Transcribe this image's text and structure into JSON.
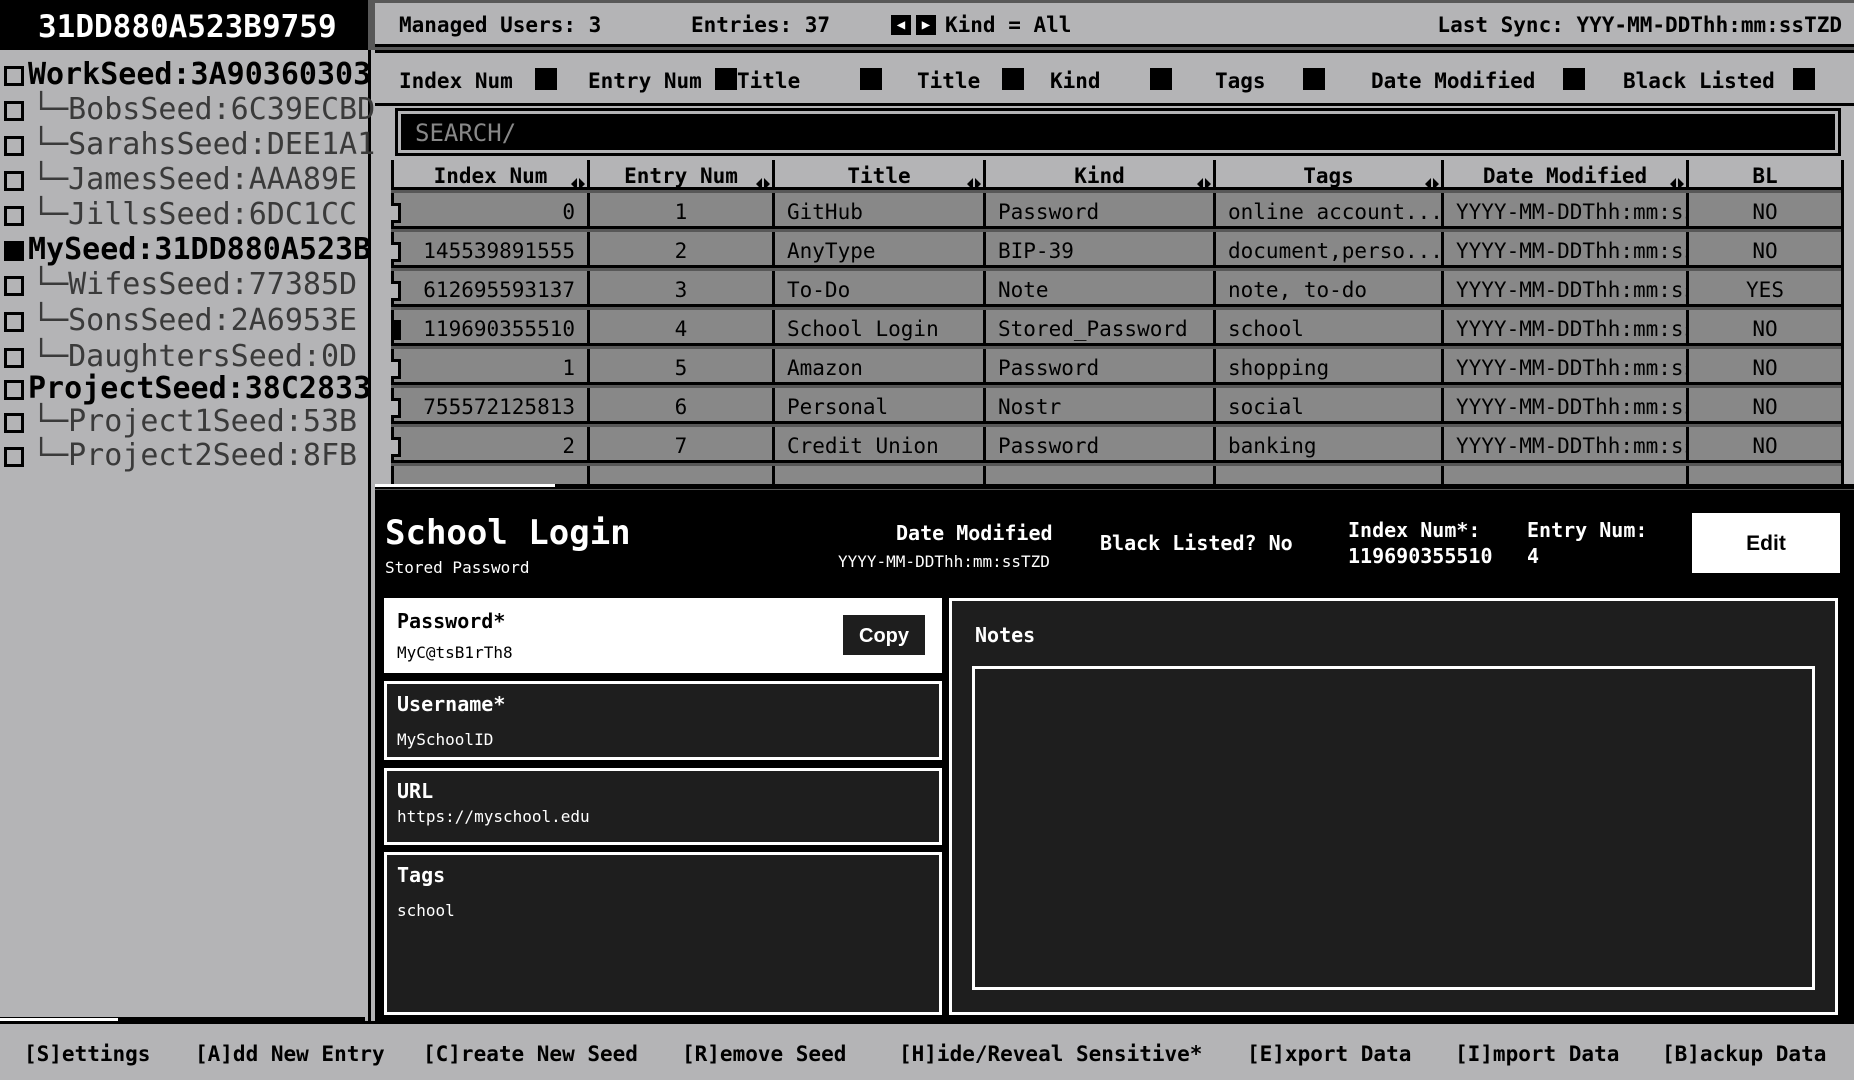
{
  "app": {
    "seed_title": "31DD880A523B9759"
  },
  "sidebar": {
    "items": [
      {
        "label": "WorkSeed:3A90360303",
        "type": "parent",
        "checked": false
      },
      {
        "label": "└─BobsSeed:6C39ECBD",
        "type": "child",
        "checked": false
      },
      {
        "label": "└─SarahsSeed:DEE1A1",
        "type": "child",
        "checked": false
      },
      {
        "label": "└─JamesSeed:AAA89E",
        "type": "child",
        "checked": false
      },
      {
        "label": "└─JillsSeed:6DC1CC",
        "type": "child",
        "checked": false
      },
      {
        "label": "MySeed:31DD880A523B",
        "type": "parent",
        "checked": true
      },
      {
        "label": "└─WifesSeed:77385D",
        "type": "child",
        "checked": false
      },
      {
        "label": "└─SonsSeed:2A6953E",
        "type": "child",
        "checked": false
      },
      {
        "label": "└─DaughtersSeed:0D",
        "type": "child",
        "checked": false
      },
      {
        "label": "ProjectSeed:38C2833",
        "type": "parent",
        "checked": false
      },
      {
        "label": "└─Project1Seed:53B",
        "type": "child",
        "checked": false
      },
      {
        "label": "└─Project2Seed:8FB",
        "type": "child",
        "checked": false
      }
    ]
  },
  "status": {
    "managed_users": "Managed Users: 3",
    "entries": "Entries: 37",
    "kind_filter": "Kind = All",
    "last_sync": "Last Sync: YYY-MM-DDThh:mm:ssTZD"
  },
  "column_toggles": [
    "Index Num",
    "Entry Num",
    "Title",
    "Title",
    "Kind",
    "Tags",
    "Date Modified",
    "Black Listed"
  ],
  "search": {
    "placeholder": "SEARCH/"
  },
  "table": {
    "headers": [
      "Index Num",
      "Entry Num",
      "Title",
      "Kind",
      "Tags",
      "Date Modified",
      "BL"
    ],
    "rows": [
      [
        "0",
        "1",
        "GitHub",
        "Password",
        "online account...",
        "YYYY-MM-DDThh:mm:ssTZD",
        "NO"
      ],
      [
        "145539891555",
        "2",
        "AnyType",
        "BIP-39",
        "document,perso...",
        "YYYY-MM-DDThh:mm:ssTZD",
        "NO"
      ],
      [
        "612695593137",
        "3",
        "To-Do",
        "Note",
        "note, to-do",
        "YYYY-MM-DDThh:mm:ssTZD",
        "YES"
      ],
      [
        "119690355510",
        "4",
        "School Login",
        "Stored_Password",
        "school",
        "YYYY-MM-DDThh:mm:ssTZD",
        "NO"
      ],
      [
        "1",
        "5",
        "Amazon",
        "Password",
        "shopping",
        "YYYY-MM-DDThh:mm:ssTZD",
        "NO"
      ],
      [
        "755572125813",
        "6",
        "Personal",
        "Nostr",
        "social",
        "YYYY-MM-DDThh:mm:ssTZD",
        "NO"
      ],
      [
        "2",
        "7",
        "Credit Union",
        "Password",
        "banking",
        "YYYY-MM-DDThh:mm:ssTZD",
        "NO"
      ]
    ],
    "selected_row": 3
  },
  "detail": {
    "title": "School Login",
    "kind": "Stored Password",
    "date_modified_label": "Date Modified",
    "date_modified_value": "YYYY-MM-DDThh:mm:ssTZD",
    "black_listed": "Black Listed? No",
    "index_label": "Index Num*:",
    "index_value": "119690355510",
    "entry_label": "Entry Num:",
    "entry_value": "4",
    "edit_label": "Edit",
    "password_label": "Password*",
    "password_value": "MyC@tsB1rTh8",
    "copy_label": "Copy",
    "username_label": "Username*",
    "username_value": "MySchoolID",
    "url_label": "URL",
    "url_value": "https://myschool.edu",
    "tags_label": "Tags",
    "tags_value": "school",
    "notes_label": "Notes"
  },
  "commands": [
    "[S]ettings",
    "[A]dd New Entry",
    "[C]reate New Seed",
    "[R]emove Seed",
    "[H]ide/Reveal Sensitive*",
    "[E]xport Data",
    "[I]mport Data",
    "[B]ackup Data"
  ],
  "colors": {
    "panel_gray": "#b4b4b6",
    "cell_gray": "#888888",
    "background": "#585858",
    "black": "#000000",
    "white": "#ffffff",
    "field_dark": "#1e1e1e"
  }
}
